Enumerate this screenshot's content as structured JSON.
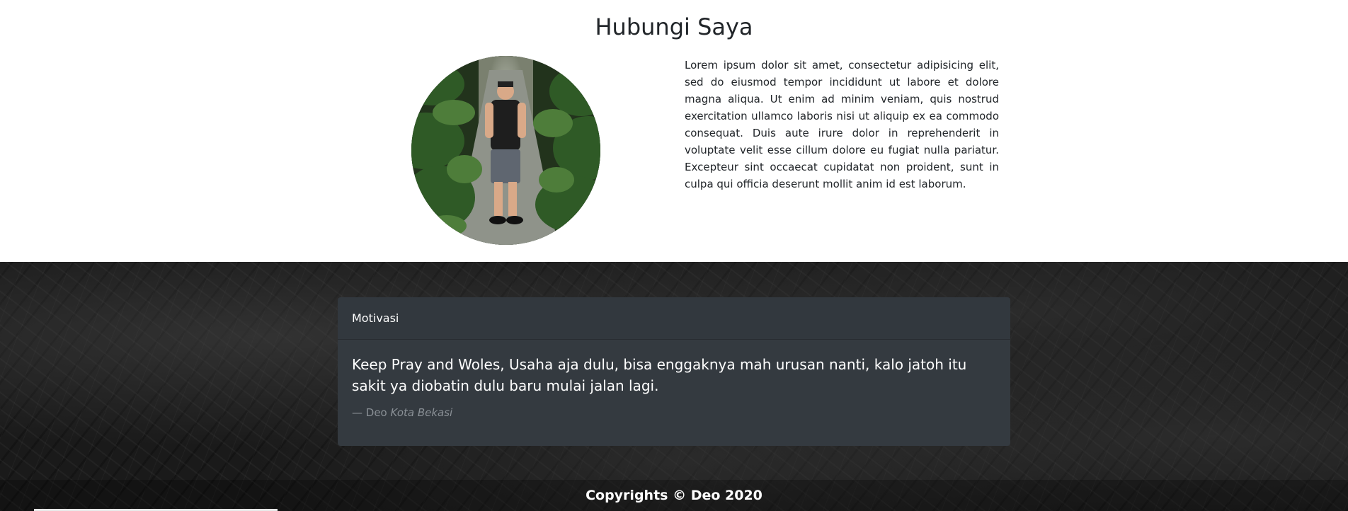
{
  "contact": {
    "title": "Hubungi Saya",
    "body": "Lorem ipsum dolor sit amet, consectetur adipisicing elit, sed do eiusmod tempor incididunt ut labore et dolore magna aliqua. Ut enim ad minim veniam, quis nostrud exercitation ullamco laboris nisi ut aliquip ex ea commodo consequat. Duis aute irure dolor in reprehenderit in voluptate velit esse cillum dolore eu fugiat nulla pariatur. Excepteur sint occaecat cupidatat non proident, sunt in culpa qui officia deserunt mollit anim id est laborum."
  },
  "quote": {
    "header": "Motivasi",
    "text": "Keep Pray and Woles, Usaha aja dulu, bisa enggaknya mah urusan nanti, kalo jatoh itu sakit ya diobatin dulu baru mulai jalan lagi.",
    "author": "— Deo",
    "source": "Kota Bekasi"
  },
  "footer": {
    "copyright": "Copyrights © Deo 2020"
  },
  "colors": {
    "card_bg": "#343a40",
    "section_bg": "#1a1a1a",
    "muted_text": "#8a9096"
  }
}
